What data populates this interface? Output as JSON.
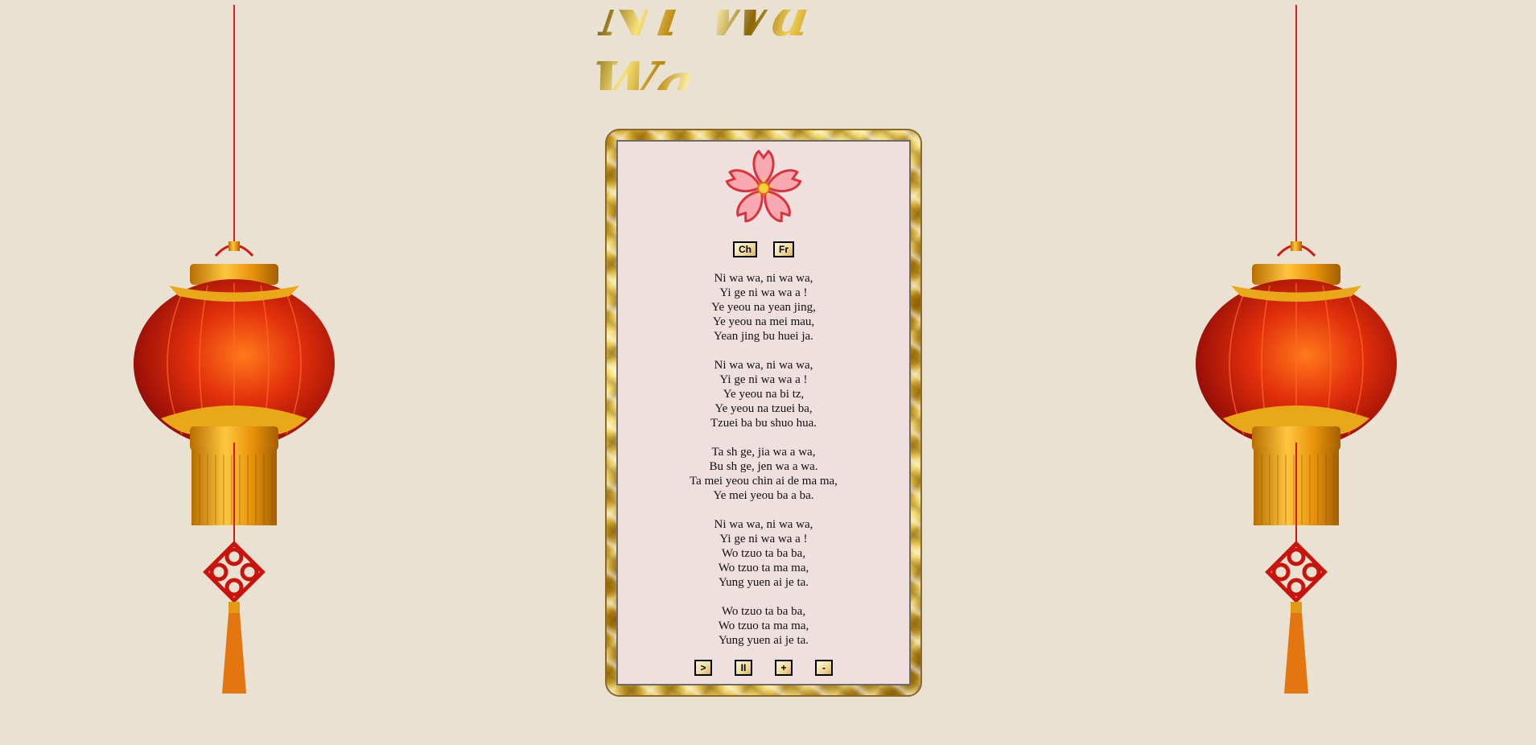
{
  "title": "Ni Wa Wa",
  "language_buttons": [
    {
      "label": "Ch",
      "name": "chinese-button"
    },
    {
      "label": "Fr",
      "name": "french-button"
    }
  ],
  "lyrics": {
    "stanzas": [
      [
        "Ni wa wa, ni wa wa,",
        "Yi ge ni wa wa a !",
        "Ye yeou na yean jing,",
        "Ye yeou na mei mau,",
        "Yean jing bu huei ja."
      ],
      [
        "Ni wa wa, ni wa wa,",
        "Yi ge ni wa wa a !",
        "Ye yeou na bi tz,",
        "Ye yeou na tzuei ba,",
        "Tzuei ba bu shuo hua."
      ],
      [
        "Ta sh ge, jia wa a wa,",
        "Bu sh ge, jen wa a wa.",
        "Ta mei yeou chin ai de ma ma,",
        "Ye mei yeou ba a ba."
      ],
      [
        "Ni wa wa, ni wa wa,",
        "Yi ge ni wa wa a !",
        "Wo tzuo ta ba ba,",
        "Wo tzuo ta ma ma,",
        "Yung yuen ai je ta."
      ],
      [
        "Wo tzuo ta ba ba,",
        "Wo tzuo ta ma ma,",
        "Yung yuen ai je ta."
      ]
    ]
  },
  "controls": [
    {
      "label": ">",
      "name": "play-button"
    },
    {
      "label": "II",
      "name": "pause-button"
    },
    {
      "label": "+",
      "name": "volume-up-button"
    },
    {
      "label": "-",
      "name": "volume-down-button"
    }
  ],
  "icons": {
    "flower": "cherry-blossom-icon",
    "lantern": "chinese-lantern-icon"
  },
  "colors": {
    "background": "#e9e2d2",
    "panel": "#f0dfdf",
    "gold": "#d4a520",
    "lantern_red": "#c8160c"
  }
}
